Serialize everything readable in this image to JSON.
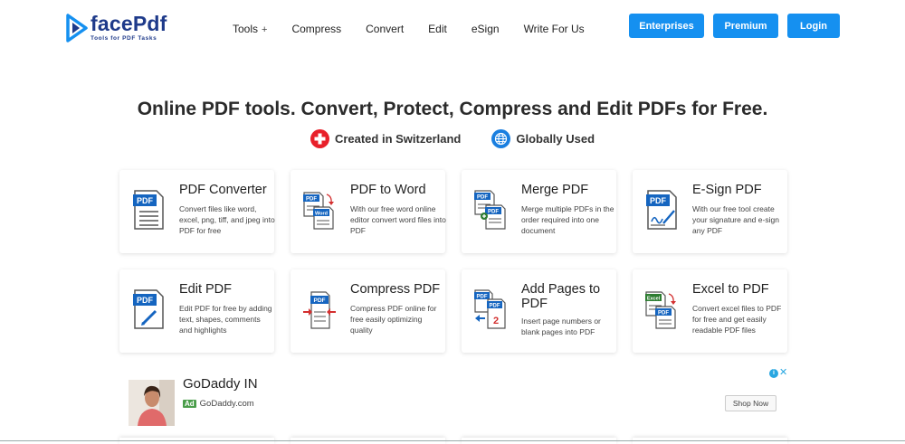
{
  "brand": {
    "name": "facePdf",
    "tagline": "Tools for PDF Tasks",
    "color": "#1e3a8a",
    "accent": "#1590f0"
  },
  "nav": {
    "items": [
      {
        "label": "Tools",
        "icon": "plus-icon",
        "suffix": "+"
      },
      {
        "label": "Compress"
      },
      {
        "label": "Convert"
      },
      {
        "label": "Edit"
      },
      {
        "label": "eSign"
      },
      {
        "label": "Write For Us"
      }
    ],
    "buttons": {
      "enterprises": "Enterprises",
      "premium": "Premium",
      "login": "Login"
    }
  },
  "hero": {
    "title": "Online PDF tools. Convert, Protect, Compress and Edit PDFs for Free.",
    "badges": [
      {
        "label": "Created in Switzerland",
        "icon": "swiss-flag-icon"
      },
      {
        "label": "Globally Used",
        "icon": "globe-icon"
      }
    ]
  },
  "tools": [
    {
      "title": "PDF Converter",
      "desc": "Convert files like word, excel, png, tiff, and jpeg into PDF for free",
      "icon": "pdf-document-icon"
    },
    {
      "title": "PDF to Word",
      "desc": "With our free word online editor convert word files into PDF",
      "icon": "pdf-to-word-icon"
    },
    {
      "title": "Merge PDF",
      "desc": "Merge multiple PDFs in the order required into one document",
      "icon": "merge-pdf-icon"
    },
    {
      "title": "E-Sign PDF",
      "desc": "With our free tool create your signature and e-sign any PDF",
      "icon": "esign-pdf-icon"
    },
    {
      "title": "Edit PDF",
      "desc": "Edit PDF for free by adding text, shapes, comments and highlights",
      "icon": "edit-pdf-icon"
    },
    {
      "title": "Compress PDF",
      "desc": "Compress PDF online for free easily optimizing quality",
      "icon": "compress-pdf-icon"
    },
    {
      "title": "Add Pages to PDF",
      "desc": "Insert page numbers or blank pages into PDF",
      "icon": "add-pages-icon"
    },
    {
      "title": "Excel to PDF",
      "desc": "Convert excel files to PDF for free and get easily readable PDF files",
      "icon": "excel-to-pdf-icon"
    }
  ],
  "icon_labels": {
    "pdf": "PDF",
    "word": "Word",
    "excel": "Excel",
    "page_number": "2"
  },
  "ad": {
    "title": "GoDaddy IN",
    "tag": "Ad",
    "domain": "GoDaddy.com",
    "cta": "Shop Now",
    "info": "i",
    "close": "✕",
    "badge_color": "#4a9d4a"
  }
}
